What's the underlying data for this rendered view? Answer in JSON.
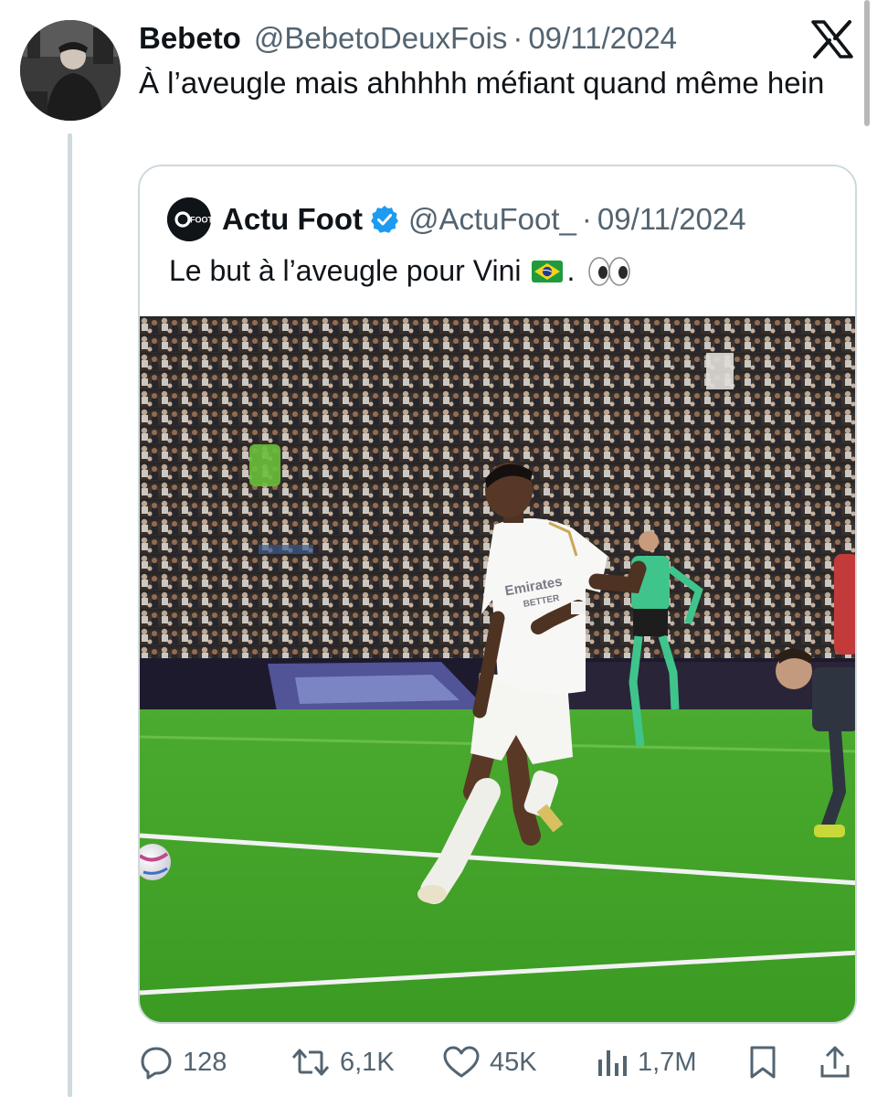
{
  "tweet": {
    "author_name": "Bebeto",
    "author_handle": "@BebetoDeuxFois",
    "separator": "·",
    "date": "09/11/2024",
    "text": "À l’aveugle mais ahhhhh méfiant quand même hein"
  },
  "quoted_tweet": {
    "author_name": "Actu Foot",
    "author_handle": "@ActuFoot_",
    "separator": "·",
    "date": "09/11/2024",
    "avatar_text": "FOOT",
    "text": "Le but à l’aveugle pour Vini",
    "after_flag": ".",
    "jersey_text_1": "Emirates",
    "jersey_text_2": "BETTER"
  },
  "actions": {
    "replies": "128",
    "reposts": "6,1K",
    "likes": "45K",
    "views": "1,7M"
  },
  "icons": [
    "x-logo-icon",
    "verified-badge-icon",
    "brazil-flag-icon",
    "eyes-emoji-icon",
    "reply-icon",
    "repost-icon",
    "like-icon",
    "views-icon",
    "bookmark-icon",
    "share-icon"
  ],
  "colors": {
    "text": "#0f1419",
    "secondary": "#536471",
    "border": "#cfd9de",
    "verified": "#1d9bf0",
    "pitch": "#3a9a2a"
  }
}
